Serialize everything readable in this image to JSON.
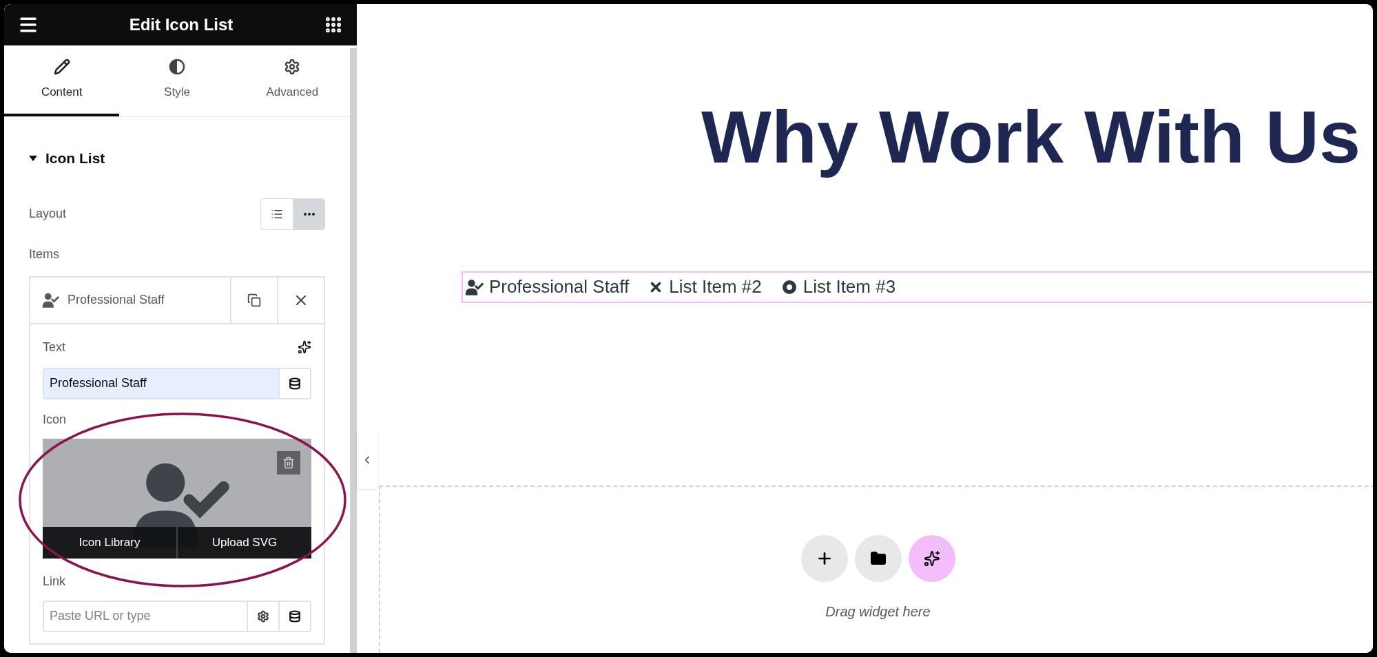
{
  "panel": {
    "title": "Edit Icon List",
    "tabs": [
      {
        "label": "Content",
        "selected": true
      },
      {
        "label": "Style",
        "selected": false
      },
      {
        "label": "Advanced",
        "selected": false
      }
    ],
    "section": {
      "title": "Icon List",
      "expanded": true
    },
    "layout": {
      "label": "Layout",
      "options": [
        {
          "kind": "list",
          "selected": false
        },
        {
          "kind": "inline",
          "selected": true
        }
      ]
    },
    "items_label": "Items",
    "item": {
      "title": "Professional Staff",
      "text_label": "Text",
      "text_value": "Professional Staff",
      "icon_label": "Icon",
      "icon_buttons": [
        "Icon Library",
        "Upload SVG"
      ],
      "link_label": "Link",
      "link_placeholder": "Paste URL or type"
    }
  },
  "canvas": {
    "heading": "Why Work With Us",
    "list_items": [
      {
        "kind": "user-check",
        "text": "Professional Staff"
      },
      {
        "kind": "times",
        "text": "List Item #2"
      },
      {
        "kind": "dot-circle",
        "text": "List Item #3"
      }
    ],
    "drop_zone": {
      "hint": "Drag widget here"
    }
  }
}
